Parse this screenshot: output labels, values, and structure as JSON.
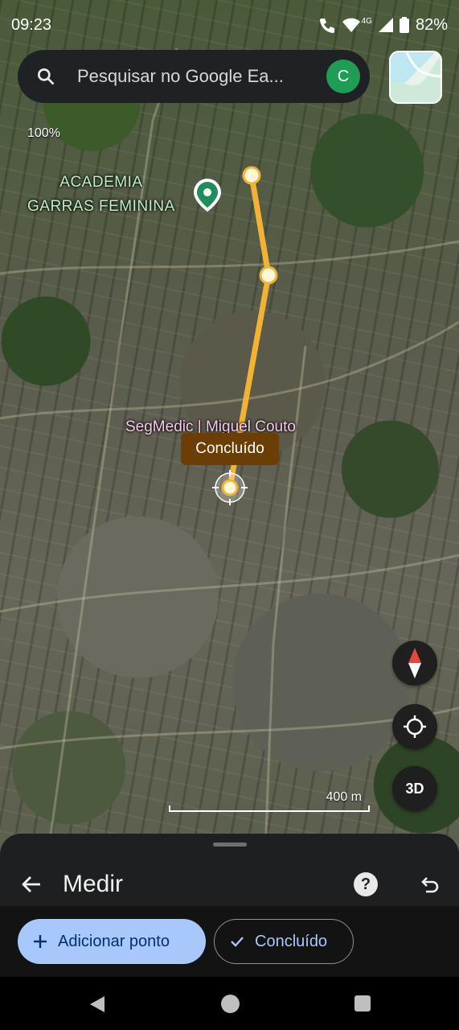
{
  "status": {
    "time": "09:23",
    "battery": "82%",
    "network": "4G"
  },
  "search": {
    "placeholder": "Pesquisar no Google Ea...",
    "avatar_letter": "C"
  },
  "map": {
    "zoom_label": "100%",
    "place_1_line_1": "ACADEMIA",
    "place_1_line_2": "GARRAS FEMININA",
    "place_2": "SegMedic | Miguel Couto",
    "done_chip": "Concluído",
    "scale_label": "400 m",
    "three_d_label": "3D",
    "route_color": "#f2b233"
  },
  "sheet": {
    "title": "Medir",
    "add_point_label": "Adicionar ponto",
    "done_label": "Concluído"
  }
}
